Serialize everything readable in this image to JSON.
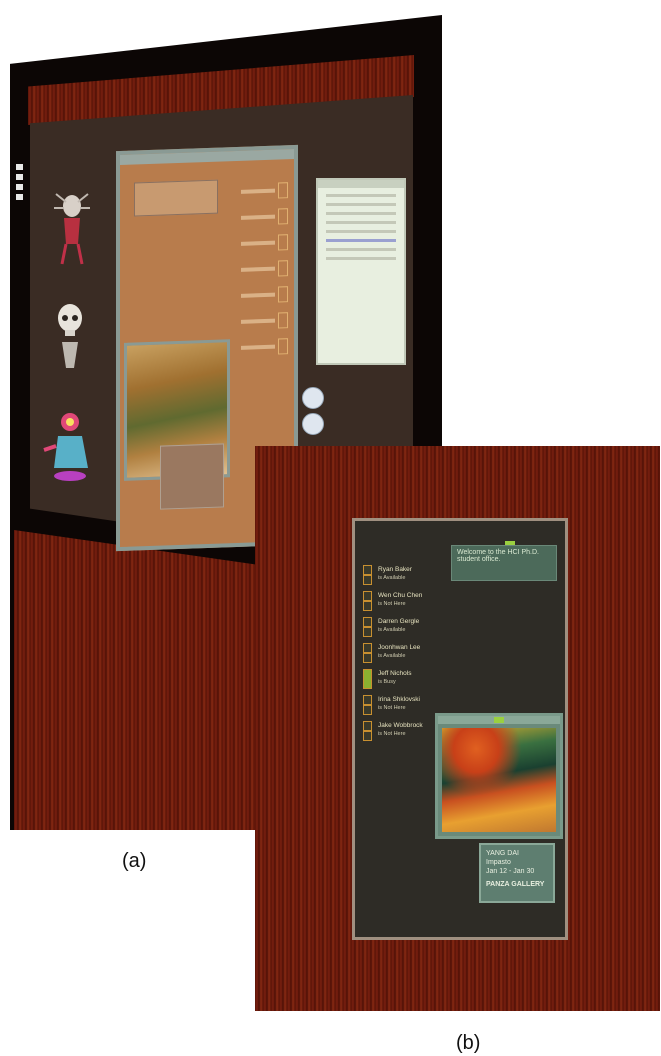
{
  "labels": {
    "a": "(a)",
    "b": "(b)"
  },
  "photo_b": {
    "welcome": "Welcome to the HCI Ph.D. student office.",
    "people": [
      {
        "name": "Ryan Baker",
        "status": "is Available"
      },
      {
        "name": "Wen Chu Chen",
        "status": "is Not Here"
      },
      {
        "name": "Darren Gergle",
        "status": "is Available"
      },
      {
        "name": "Joonhwan Lee",
        "status": "is Available"
      },
      {
        "name": "Jeff Nichols",
        "status": "is Busy"
      },
      {
        "name": "Irina Shklovski",
        "status": "is Not Here"
      },
      {
        "name": "Jake Wobbrock",
        "status": "is Not Here"
      }
    ],
    "exhibit": {
      "artist": "YANG DAI",
      "title": "Impasto",
      "dates": "Jan 12 - Jan 30",
      "gallery": "PANZA GALLERY"
    }
  },
  "colors": {
    "wood": "#6a1c0c",
    "screen_dark": "#2e2c26",
    "panel_teal": "#5e7e70",
    "accent_green": "#9ad040",
    "status_amber": "#c89030"
  }
}
